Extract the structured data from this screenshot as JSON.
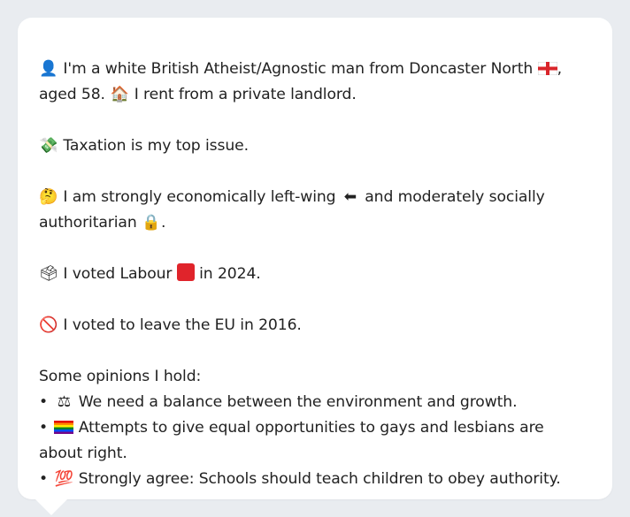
{
  "profile": {
    "p1": {
      "icon_person": "👤",
      "text_a": "I'm a white British Atheist/Agnostic man from Doncaster North",
      "text_b": ", aged 58.",
      "icon_house": "🏠",
      "text_c": "I rent from a private landlord."
    },
    "p2": {
      "icon": "💸",
      "text": "Taxation is my top issue."
    },
    "p3": {
      "icon_think": "🤔",
      "text_a": "I am strongly economically left-wing",
      "icon_arrow": "⬅",
      "text_b": "and moderately socially authoritarian",
      "icon_lock": "🔒",
      "text_c": "."
    },
    "p4": {
      "icon": "🗳",
      "text_a": "I voted Labour",
      "text_b": "in 2024."
    },
    "p5": {
      "icon": "🚫",
      "text": "I voted to leave the EU in 2016."
    },
    "opinions": {
      "heading": "Some opinions I hold:",
      "bullet": "•",
      "items": [
        {
          "icon": "⚖",
          "text": "We need a balance between the environment and growth."
        },
        {
          "icon": "🏳",
          "text": "Attempts to give equal opportunities to gays and lesbians are about right."
        },
        {
          "icon": "💯",
          "text": "Strongly agree: Schools should teach children to obey authority."
        }
      ]
    }
  },
  "colors": {
    "labour_red": "#e0242b",
    "card_bg": "#ffffff",
    "page_bg": "#e9ecf0"
  }
}
